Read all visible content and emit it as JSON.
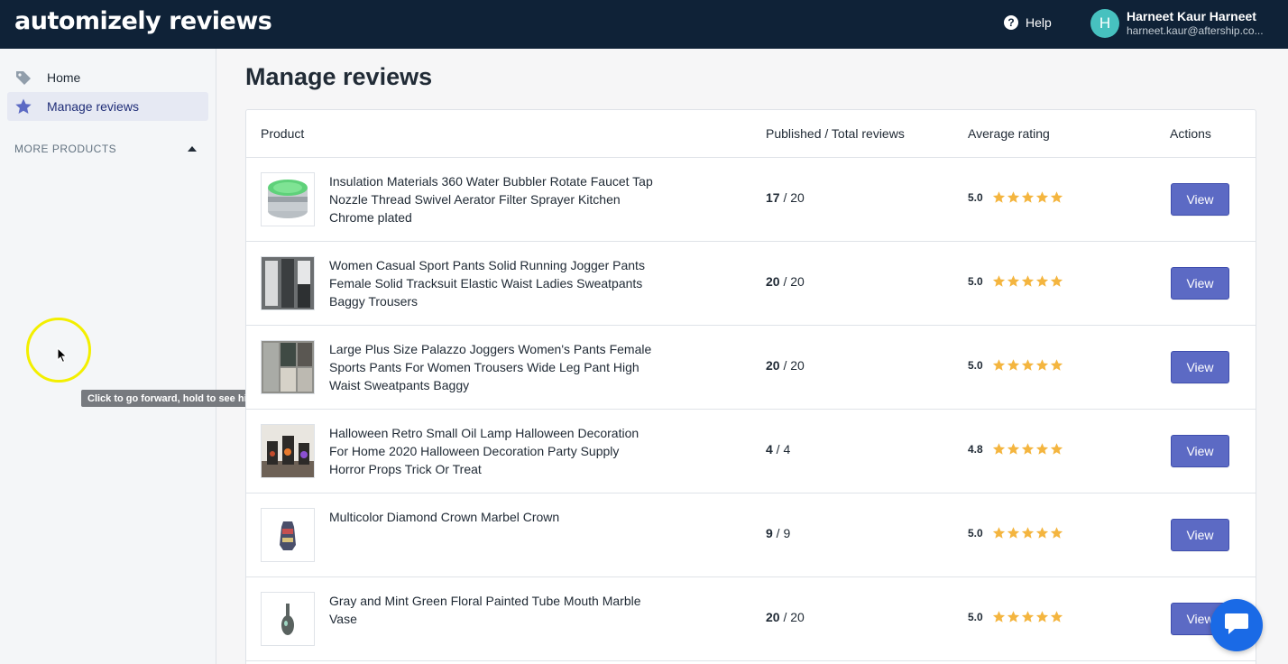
{
  "header": {
    "logo": "automizely reviews",
    "help_label": "Help",
    "user_initial": "H",
    "user_name": "Harneet Kaur Harneet",
    "user_email": "harneet.kaur@aftership.co..."
  },
  "sidebar": {
    "items": [
      {
        "label": "Home",
        "icon": "tag-icon",
        "active": false
      },
      {
        "label": "Manage reviews",
        "icon": "star-icon",
        "active": true
      }
    ],
    "more_products": "MORE PRODUCTS"
  },
  "tooltip": "Click to go forward, hold to see history",
  "page": {
    "title": "Manage reviews",
    "columns": [
      "Product",
      "Published / Total reviews",
      "Average rating",
      "Actions"
    ],
    "rows": [
      {
        "name": "Insulation Materials 360 Water Bubbler Rotate Faucet Tap Nozzle Thread Swivel Aerator Filter Sprayer Kitchen Chrome plated",
        "published": "17",
        "total": "20",
        "rating": "5.0",
        "stars": 5,
        "action": "View"
      },
      {
        "name": "Women Casual Sport Pants Solid Running Jogger Pants Female Solid Tracksuit Elastic Waist Ladies Sweatpants Baggy Trousers",
        "published": "20",
        "total": "20",
        "rating": "5.0",
        "stars": 5,
        "action": "View"
      },
      {
        "name": "Large Plus Size Palazzo Joggers Women's Pants Female Sports Pants For Women Trousers Wide Leg Pant High Waist Sweatpants Baggy",
        "published": "20",
        "total": "20",
        "rating": "5.0",
        "stars": 5,
        "action": "View"
      },
      {
        "name": "Halloween Retro Small Oil Lamp Halloween Decoration For Home 2020 Halloween Decoration Party Supply Horror Props Trick Or Treat",
        "published": "4",
        "total": "4",
        "rating": "4.8",
        "stars": 5,
        "action": "View"
      },
      {
        "name": "Multicolor Diamond Crown Marbel Crown",
        "published": "9",
        "total": "9",
        "rating": "5.0",
        "stars": 5,
        "action": "View"
      },
      {
        "name": "Gray and Mint Green Floral Painted Tube Mouth Marble Vase",
        "published": "20",
        "total": "20",
        "rating": "5.0",
        "stars": 5,
        "action": "View"
      }
    ]
  },
  "colors": {
    "topbar": "#0f2237",
    "accent": "#5c6ac4",
    "star": "#f4b53f",
    "chat": "#1a6ae6"
  }
}
